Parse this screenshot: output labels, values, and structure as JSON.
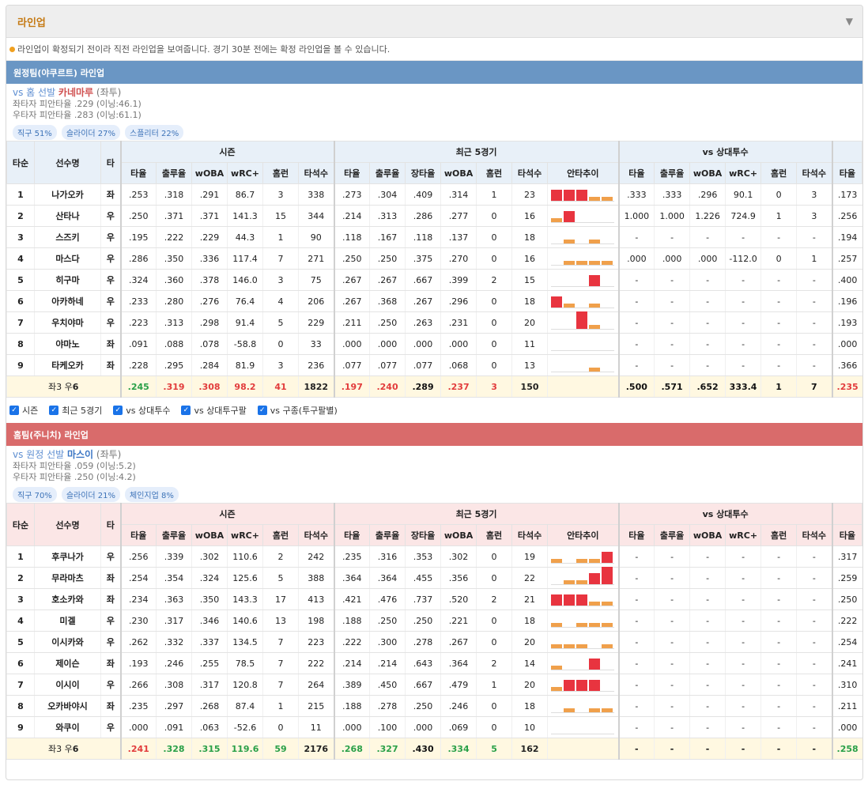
{
  "header": {
    "title": "라인업"
  },
  "note": "라인업이 확정되기 전이라 직전 라인업을 보여줍니다. 경기 30분 전에는 확정 라인업을 볼 수 있습니다.",
  "columns": {
    "order": "타순",
    "name": "선수명",
    "hand": "타",
    "season": "시즌",
    "recent": "최근 5경기",
    "vsp": "vs 상대투수",
    "season_cols": [
      "타율",
      "출루율",
      "wOBA",
      "wRC+",
      "홈런",
      "타석수"
    ],
    "recent_cols": [
      "타율",
      "출루율",
      "장타율",
      "wOBA",
      "홈런",
      "타석수",
      "안타추이"
    ],
    "vsp_cols": [
      "타율",
      "출루율",
      "wOBA",
      "wRC+",
      "홈런",
      "타석수"
    ],
    "extra_col": "타율"
  },
  "checks": [
    "시즌",
    "최근 5경기",
    "vs 상대투수",
    "vs 상대투구팔",
    "vs 구종(투구팔별)"
  ],
  "away": {
    "bar": "원정팀(야쿠르트) 라인업",
    "vs_prefix": "vs 홈 선발",
    "pitcher": "카네마루",
    "pitcher_hand": "(좌투)",
    "split1": "좌타자 피안타율 .229 (이닝:46.1)",
    "split2": "우타자 피안타율 .283 (이닝:61.1)",
    "pills": [
      "직구 51%",
      "슬라이더 27%",
      "스플리터 22%"
    ],
    "rows": [
      {
        "o": "1",
        "n": "나가오카",
        "h": "좌",
        "s": [
          ".253",
          ".318",
          ".291",
          "86.7",
          "3",
          "338"
        ],
        "r": [
          ".273",
          ".304",
          ".409",
          ".314",
          "1",
          "23"
        ],
        "sp": [
          3,
          3,
          3,
          1,
          1
        ],
        "v": [
          ".333",
          ".333",
          ".296",
          "90.1",
          "0",
          "3"
        ],
        "x": ".173"
      },
      {
        "o": "2",
        "n": "산타나",
        "h": "우",
        "s": [
          ".250",
          ".371",
          ".371",
          "141.3",
          "15",
          "344"
        ],
        "r": [
          ".214",
          ".313",
          ".286",
          ".277",
          "0",
          "16"
        ],
        "sp": [
          1,
          3,
          0,
          0,
          0
        ],
        "v": [
          "1.000",
          "1.000",
          "1.226",
          "724.9",
          "1",
          "3"
        ],
        "x": ".256"
      },
      {
        "o": "3",
        "n": "스즈키",
        "h": "우",
        "s": [
          ".195",
          ".222",
          ".229",
          "44.3",
          "1",
          "90"
        ],
        "r": [
          ".118",
          ".167",
          ".118",
          ".137",
          "0",
          "18"
        ],
        "sp": [
          0,
          1,
          0,
          1,
          0
        ],
        "v": [
          "-",
          "-",
          "-",
          "-",
          "-",
          "-"
        ],
        "x": ".194"
      },
      {
        "o": "4",
        "n": "마스다",
        "h": "우",
        "s": [
          ".286",
          ".350",
          ".336",
          "117.4",
          "7",
          "271"
        ],
        "r": [
          ".250",
          ".250",
          ".375",
          ".270",
          "0",
          "16"
        ],
        "sp": [
          0,
          1,
          1,
          1,
          1
        ],
        "v": [
          ".000",
          ".000",
          ".000",
          "-112.0",
          "0",
          "1"
        ],
        "x": ".257"
      },
      {
        "o": "5",
        "n": "히구마",
        "h": "우",
        "s": [
          ".324",
          ".360",
          ".378",
          "146.0",
          "3",
          "75"
        ],
        "r": [
          ".267",
          ".267",
          ".667",
          ".399",
          "2",
          "15"
        ],
        "sp": [
          0,
          0,
          0,
          3,
          0
        ],
        "v": [
          "-",
          "-",
          "-",
          "-",
          "-",
          "-"
        ],
        "x": ".400"
      },
      {
        "o": "6",
        "n": "아카하네",
        "h": "우",
        "s": [
          ".233",
          ".280",
          ".276",
          "76.4",
          "4",
          "206"
        ],
        "r": [
          ".267",
          ".368",
          ".267",
          ".296",
          "0",
          "18"
        ],
        "sp": [
          3,
          1,
          0,
          1,
          0
        ],
        "v": [
          "-",
          "-",
          "-",
          "-",
          "-",
          "-"
        ],
        "x": ".196"
      },
      {
        "o": "7",
        "n": "우치야마",
        "h": "우",
        "s": [
          ".223",
          ".313",
          ".298",
          "91.4",
          "5",
          "229"
        ],
        "r": [
          ".211",
          ".250",
          ".263",
          ".231",
          "0",
          "20"
        ],
        "sp": [
          0,
          0,
          4,
          1,
          0
        ],
        "v": [
          "-",
          "-",
          "-",
          "-",
          "-",
          "-"
        ],
        "x": ".193"
      },
      {
        "o": "8",
        "n": "야마노",
        "h": "좌",
        "s": [
          ".091",
          ".088",
          ".078",
          "-58.8",
          "0",
          "33"
        ],
        "r": [
          ".000",
          ".000",
          ".000",
          ".000",
          "0",
          "11"
        ],
        "sp": [
          0,
          0,
          0,
          0,
          0
        ],
        "v": [
          "-",
          "-",
          "-",
          "-",
          "-",
          "-"
        ],
        "x": ".000"
      },
      {
        "o": "9",
        "n": "타케오카",
        "h": "좌",
        "s": [
          ".228",
          ".295",
          ".284",
          "81.9",
          "3",
          "236"
        ],
        "r": [
          ".077",
          ".077",
          ".077",
          ".068",
          "0",
          "13"
        ],
        "sp": [
          0,
          0,
          0,
          1,
          0
        ],
        "v": [
          "-",
          "-",
          "-",
          "-",
          "-",
          "-"
        ],
        "x": ".366"
      }
    ],
    "total": {
      "label_a": "좌3 우",
      "label_b": "6",
      "s": [
        ".245",
        ".319",
        ".308",
        "98.2",
        "41",
        "1822"
      ],
      "r": [
        ".197",
        ".240",
        ".289",
        ".237",
        "3",
        "150"
      ],
      "v": [
        ".500",
        ".571",
        ".652",
        "333.4",
        "1",
        "7"
      ],
      "x": ".235"
    }
  },
  "home": {
    "bar": "홈팀(주니치) 라인업",
    "vs_prefix": "vs 원정 선발",
    "pitcher": "마스이",
    "pitcher_hand": "(좌투)",
    "split1": "좌타자 피안타율 .059 (이닝:5.2)",
    "split2": "우타자 피안타율 .250 (이닝:4.2)",
    "pills": [
      "직구 70%",
      "슬라이더 21%",
      "체인지업 8%"
    ],
    "rows": [
      {
        "o": "1",
        "n": "후쿠나가",
        "h": "우",
        "s": [
          ".256",
          ".339",
          ".302",
          "110.6",
          "2",
          "242"
        ],
        "r": [
          ".235",
          ".316",
          ".353",
          ".302",
          "0",
          "19"
        ],
        "sp": [
          1,
          0,
          1,
          1,
          3
        ],
        "v": [
          "-",
          "-",
          "-",
          "-",
          "-",
          "-"
        ],
        "x": ".317"
      },
      {
        "o": "2",
        "n": "무라마츠",
        "h": "좌",
        "s": [
          ".254",
          ".354",
          ".324",
          "125.6",
          "5",
          "388"
        ],
        "r": [
          ".364",
          ".364",
          ".455",
          ".356",
          "0",
          "22"
        ],
        "sp": [
          0,
          1,
          1,
          3,
          4
        ],
        "v": [
          "-",
          "-",
          "-",
          "-",
          "-",
          "-"
        ],
        "x": ".259"
      },
      {
        "o": "3",
        "n": "호소카와",
        "h": "좌",
        "s": [
          ".234",
          ".363",
          ".350",
          "143.3",
          "17",
          "413"
        ],
        "r": [
          ".421",
          ".476",
          ".737",
          ".520",
          "2",
          "21"
        ],
        "sp": [
          3,
          3,
          3,
          1,
          1
        ],
        "v": [
          "-",
          "-",
          "-",
          "-",
          "-",
          "-"
        ],
        "x": ".250"
      },
      {
        "o": "4",
        "n": "미겔",
        "h": "우",
        "s": [
          ".230",
          ".317",
          ".346",
          "140.6",
          "13",
          "198"
        ],
        "r": [
          ".188",
          ".250",
          ".250",
          ".221",
          "0",
          "18"
        ],
        "sp": [
          1,
          0,
          1,
          1,
          1
        ],
        "v": [
          "-",
          "-",
          "-",
          "-",
          "-",
          "-"
        ],
        "x": ".222"
      },
      {
        "o": "5",
        "n": "이시카와",
        "h": "우",
        "s": [
          ".262",
          ".332",
          ".337",
          "134.5",
          "7",
          "223"
        ],
        "r": [
          ".222",
          ".300",
          ".278",
          ".267",
          "0",
          "20"
        ],
        "sp": [
          1,
          1,
          1,
          0,
          1
        ],
        "v": [
          "-",
          "-",
          "-",
          "-",
          "-",
          "-"
        ],
        "x": ".254"
      },
      {
        "o": "6",
        "n": "제이슨",
        "h": "좌",
        "s": [
          ".193",
          ".246",
          ".255",
          "78.5",
          "7",
          "222"
        ],
        "r": [
          ".214",
          ".214",
          ".643",
          ".364",
          "2",
          "14"
        ],
        "sp": [
          1,
          0,
          0,
          3,
          0
        ],
        "v": [
          "-",
          "-",
          "-",
          "-",
          "-",
          "-"
        ],
        "x": ".241"
      },
      {
        "o": "7",
        "n": "이시이",
        "h": "우",
        "s": [
          ".266",
          ".308",
          ".317",
          "120.8",
          "7",
          "264"
        ],
        "r": [
          ".389",
          ".450",
          ".667",
          ".479",
          "1",
          "20"
        ],
        "sp": [
          1,
          3,
          3,
          3,
          0
        ],
        "v": [
          "-",
          "-",
          "-",
          "-",
          "-",
          "-"
        ],
        "x": ".310"
      },
      {
        "o": "8",
        "n": "오카바야시",
        "h": "좌",
        "s": [
          ".235",
          ".297",
          ".268",
          "87.4",
          "1",
          "215"
        ],
        "r": [
          ".188",
          ".278",
          ".250",
          ".246",
          "0",
          "18"
        ],
        "sp": [
          0,
          1,
          0,
          1,
          1
        ],
        "v": [
          "-",
          "-",
          "-",
          "-",
          "-",
          "-"
        ],
        "x": ".211"
      },
      {
        "o": "9",
        "n": "와쿠이",
        "h": "우",
        "s": [
          ".000",
          ".091",
          ".063",
          "-52.6",
          "0",
          "11"
        ],
        "r": [
          ".000",
          ".100",
          ".000",
          ".069",
          "0",
          "10"
        ],
        "sp": [
          0,
          0,
          0,
          0,
          0
        ],
        "v": [
          "-",
          "-",
          "-",
          "-",
          "-",
          "-"
        ],
        "x": ".000"
      }
    ],
    "total": {
      "label_a": "좌3 우",
      "label_b": "6",
      "s": [
        ".241",
        ".328",
        ".315",
        "119.6",
        "59",
        "2176"
      ],
      "r": [
        ".268",
        ".327",
        ".430",
        ".334",
        "5",
        "162"
      ],
      "v": [
        "-",
        "-",
        "-",
        "-",
        "-",
        "-"
      ],
      "x": ".258"
    }
  },
  "colors": {
    "spark_hit": "#e8343f",
    "spark_out": "#f0a04b",
    "away_bar": "#6a96c4",
    "home_bar": "#d96b6b",
    "total_row": "#fff8e1"
  }
}
